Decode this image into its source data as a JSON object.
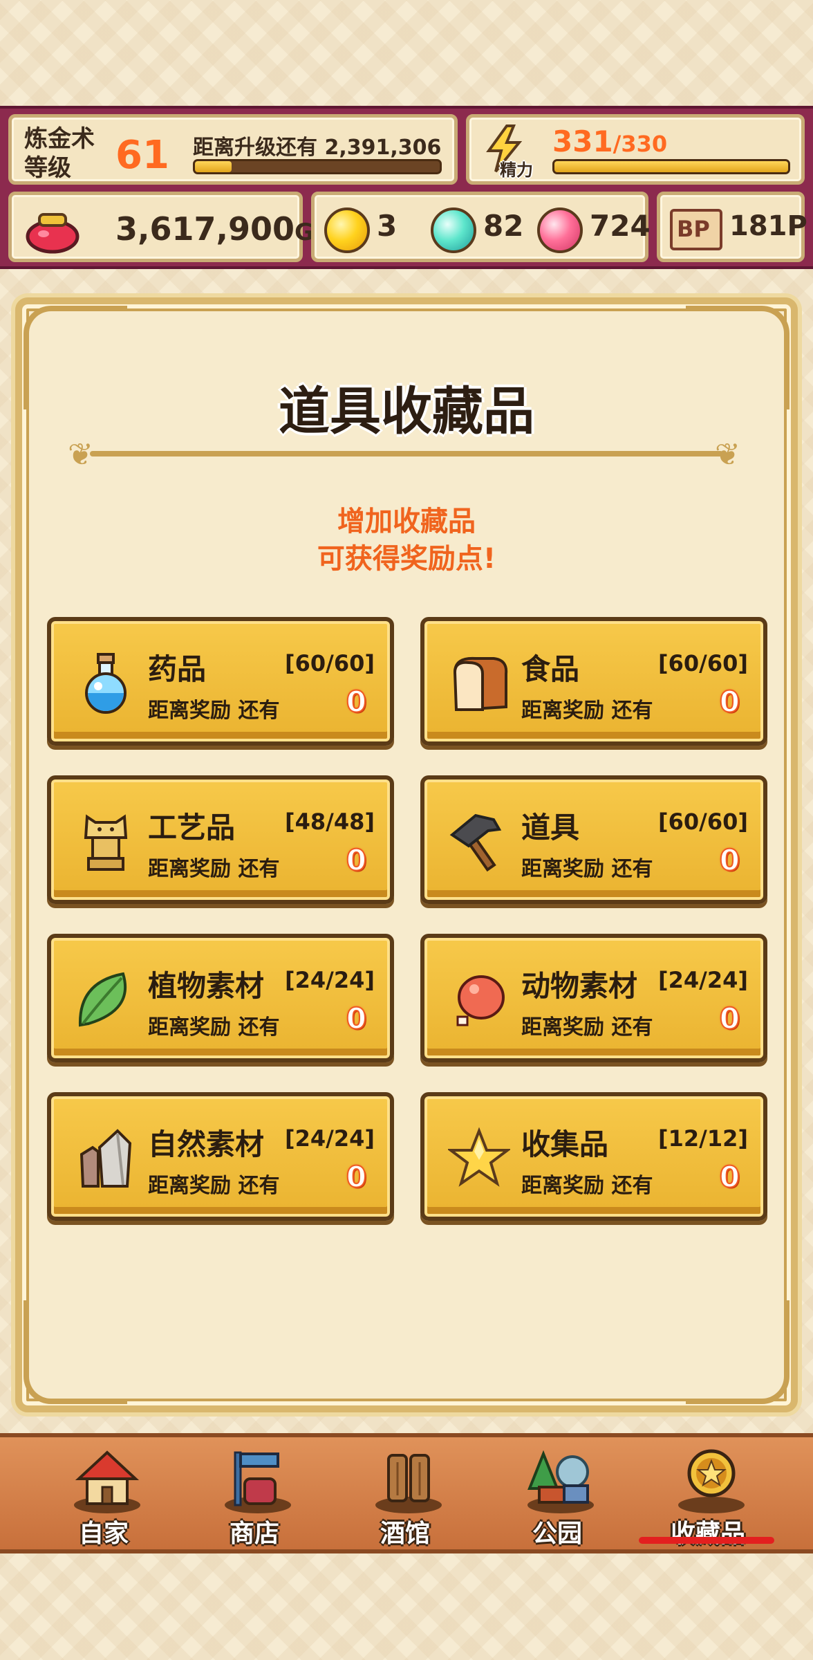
{
  "header": {
    "level_label": "炼金术\n等级",
    "level_value": "61",
    "next_level_text": "距离升级还有 2,391,306",
    "level_progress": 0.15,
    "energy_current": "331",
    "energy_max": "/330",
    "energy_label": "精力",
    "energy_progress": 1.0,
    "gold_amount": "3,617,900",
    "gold_unit": "G",
    "yellow_orbs": "3",
    "teal_orbs": "82",
    "pink_orbs": "724",
    "bp_label": "BP",
    "bp_amount": "181P"
  },
  "panel": {
    "title": "道具收藏品",
    "subtitle_line1": "增加收藏品",
    "subtitle_line2": "可获得奖励点!"
  },
  "categories": [
    {
      "name": "药品",
      "count": "[60/60]",
      "reward_text": "距离奖励 还有",
      "reward_value": "0",
      "icon": "potion-icon"
    },
    {
      "name": "食品",
      "count": "[60/60]",
      "reward_text": "距离奖励 还有",
      "reward_value": "0",
      "icon": "bread-icon"
    },
    {
      "name": "工艺品",
      "count": "[48/48]",
      "reward_text": "距离奖励 还有",
      "reward_value": "0",
      "icon": "figurine-icon"
    },
    {
      "name": "道具",
      "count": "[60/60]",
      "reward_text": "距离奖励 还有",
      "reward_value": "0",
      "icon": "hammer-icon"
    },
    {
      "name": "植物素材",
      "count": "[24/24]",
      "reward_text": "距离奖励 还有",
      "reward_value": "0",
      "icon": "leaf-icon"
    },
    {
      "name": "动物素材",
      "count": "[24/24]",
      "reward_text": "距离奖励 还有",
      "reward_value": "0",
      "icon": "meat-icon"
    },
    {
      "name": "自然素材",
      "count": "[24/24]",
      "reward_text": "距离奖励 还有",
      "reward_value": "0",
      "icon": "stone-icon"
    },
    {
      "name": "收集品",
      "count": "[12/12]",
      "reward_text": "距离奖励 还有",
      "reward_value": "0",
      "icon": "star-icon"
    }
  ],
  "nav": [
    {
      "label": "自家",
      "icon": "house-icon"
    },
    {
      "label": "商店",
      "icon": "shop-icon"
    },
    {
      "label": "酒馆",
      "icon": "tavern-icon"
    },
    {
      "label": "公园",
      "icon": "park-icon"
    },
    {
      "label": "收藏品",
      "icon": "collection-medal-icon",
      "active": true
    }
  ],
  "colors": {
    "header_bg": "#8c2a4e",
    "accent_orange": "#ff6a21",
    "card_gold": "#eab330",
    "nav_bg": "#d3804a",
    "active_underline": "#e31f1f"
  }
}
